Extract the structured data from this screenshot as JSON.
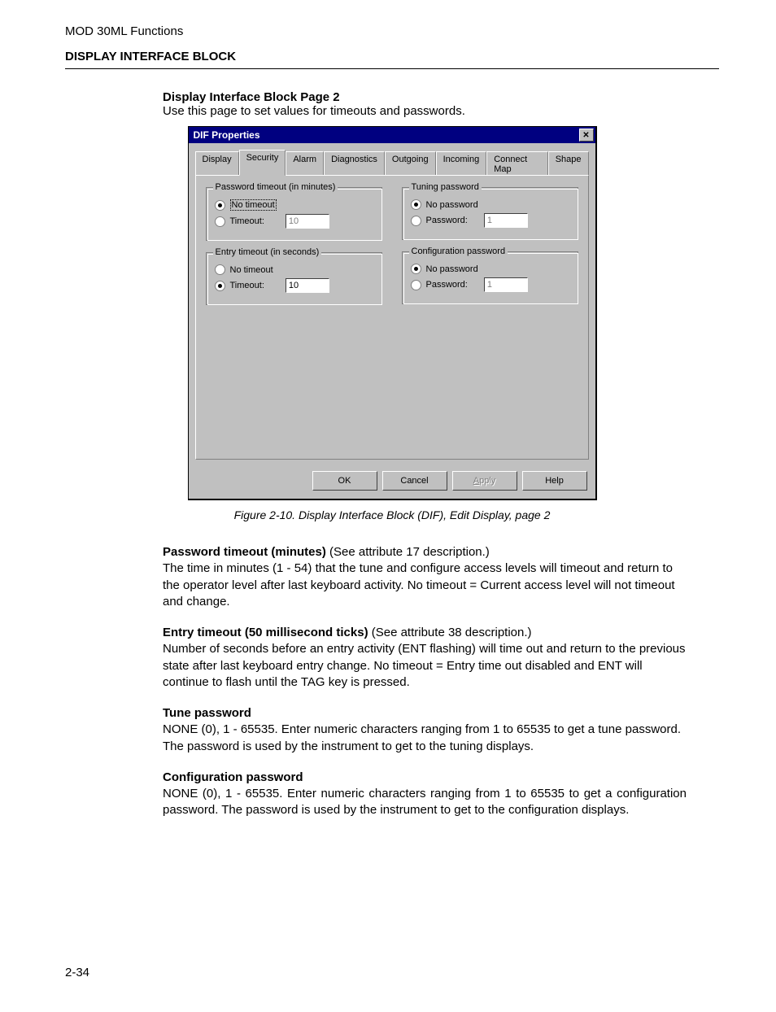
{
  "header": "MOD 30ML Functions",
  "section_title": "DISPLAY INTERFACE BLOCK",
  "sub_title": "Display Interface Block Page 2",
  "sub_intro": "Use this page to set values for timeouts and passwords.",
  "dialog": {
    "title": "DIF Properties",
    "tabs": [
      "Display",
      "Security",
      "Alarm",
      "Diagnostics",
      "Outgoing",
      "Incoming",
      "Connect Map",
      "Shape"
    ],
    "selected_tab": 1,
    "groups": {
      "pwd_timeout": {
        "legend": "Password timeout (in minutes)",
        "no_label": "No timeout",
        "val_label": "Timeout:",
        "value": "10",
        "selected": "no"
      },
      "entry_timeout": {
        "legend": "Entry timeout (in seconds)",
        "no_label": "No timeout",
        "val_label": "Timeout:",
        "value": "10",
        "selected": "val"
      },
      "tune_pwd": {
        "legend": "Tuning password",
        "no_label": "No password",
        "val_label": "Password:",
        "value": "1",
        "selected": "no"
      },
      "cfg_pwd": {
        "legend": "Configuration password",
        "no_label": "No password",
        "val_label": "Password:",
        "value": "1",
        "selected": "no"
      }
    },
    "buttons": {
      "ok": "OK",
      "cancel": "Cancel",
      "apply_u": "A",
      "apply_rest": "pply",
      "help": "Help"
    }
  },
  "figure_caption": "Figure 2-10.  Display Interface Block (DIF), Edit Display, page 2",
  "body": {
    "p1_head": "Password timeout (minutes)",
    "p1_note": "  (See attribute 17 description.)",
    "p1_text": "The time in minutes (1 - 54) that the tune and configure access levels will timeout and return to the operator level after last keyboard activity. No timeout = Current access level will not timeout and change.",
    "p2_head": "Entry timeout (50 millisecond ticks)",
    "p2_note": " (See attribute 38 description.)",
    "p2_text": "Number of seconds before an entry activity (ENT flashing) will time out and return to the previous state after last keyboard entry change. No timeout = Entry time out disabled and ENT will continue to flash until the TAG key is pressed.",
    "p3_head": "Tune password",
    "p3_text": "NONE (0), 1 - 65535. Enter numeric characters ranging from 1 to 65535 to get a tune password.  The password is used by the instrument to get to the tuning displays.",
    "p4_head": "Configuration password",
    "p4_text": "NONE (0), 1 - 65535. Enter numeric characters ranging from 1 to 65535 to get a configuration password.  The password is used by the instrument to get to the configuration displays."
  },
  "page_number": "2-34"
}
